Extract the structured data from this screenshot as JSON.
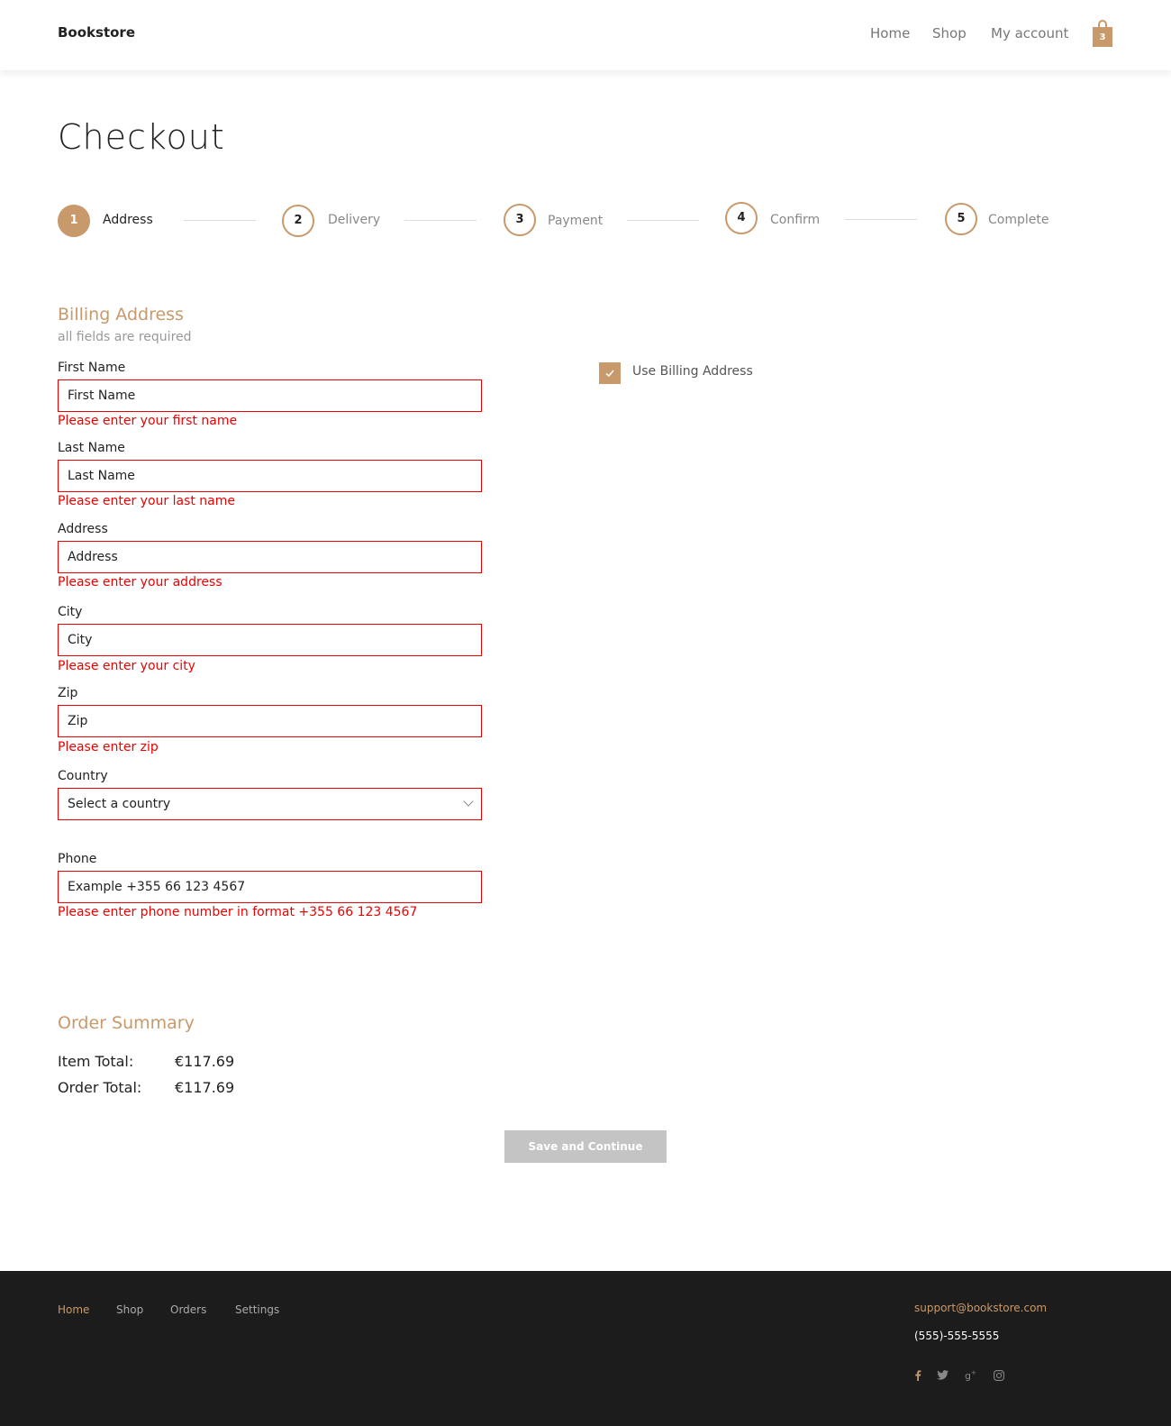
{
  "header": {
    "brand": "Bookstore",
    "nav": [
      "Home",
      "Shop",
      "My account"
    ],
    "cart_count": "3"
  },
  "page_title": "Checkout",
  "steps": [
    {
      "number": "1",
      "label": "Address"
    },
    {
      "number": "2",
      "label": "Delivery"
    },
    {
      "number": "3",
      "label": "Payment"
    },
    {
      "number": "4",
      "label": "Confirm"
    },
    {
      "number": "5",
      "label": "Complete"
    }
  ],
  "billing": {
    "title": "Billing Address",
    "note": "all fields are required",
    "fields": [
      {
        "label": "First Name",
        "placeholder": "First Name",
        "error": "Please enter your first name"
      },
      {
        "label": "Last Name",
        "placeholder": "Last Name",
        "error": "Please enter your last name"
      },
      {
        "label": "Address",
        "placeholder": "Address",
        "error": "Please enter your address"
      },
      {
        "label": "City",
        "placeholder": "City",
        "error": "Please enter your city"
      },
      {
        "label": "Zip",
        "placeholder": "Zip",
        "error": "Please enter zip"
      }
    ],
    "country": {
      "label": "Country",
      "selected": "Select a country"
    },
    "phone": {
      "label": "Phone",
      "placeholder": "Example +355 66 123 4567",
      "error": "Please enter phone number in format +355 66 123 4567"
    }
  },
  "use_billing_label": "Use Billing Address",
  "summary": {
    "title": "Order Summary",
    "item_total_label": "Item Total:",
    "item_total_value": "€117.69",
    "order_total_label": "Order Total:",
    "order_total_value": "€117.69"
  },
  "save_button": "Save and Continue",
  "footer": {
    "links": [
      "Home",
      "Shop",
      "Orders",
      "Settings"
    ],
    "email": "support@bookstore.com",
    "phone": "(555)-555-5555",
    "social_icons": [
      "facebook-icon",
      "twitter-icon",
      "google-plus-icon",
      "instagram-icon"
    ]
  },
  "colors": {
    "accent": "#c8996a",
    "error": "#e00000",
    "footer_bg": "#1c1c1c",
    "button_disabled": "#c4c4c4"
  }
}
